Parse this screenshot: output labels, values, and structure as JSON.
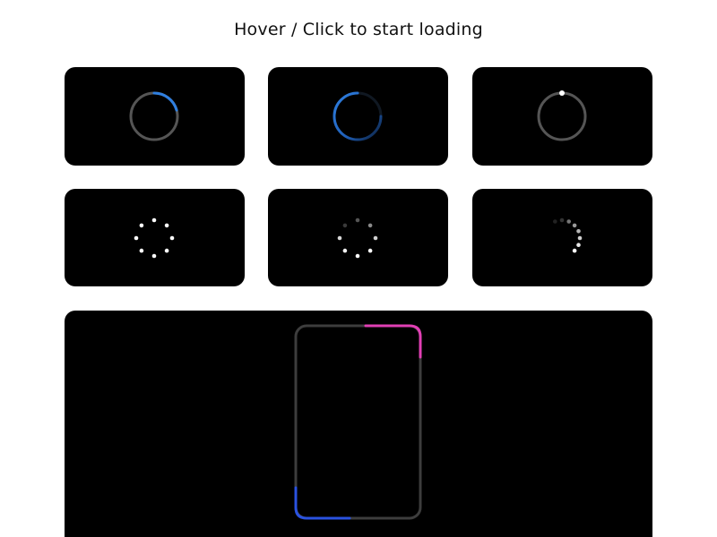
{
  "page": {
    "title": "Hover / Click to start loading"
  },
  "colors": {
    "background": "#ffffff",
    "card": "#000000",
    "track": "#4a4a4a",
    "accent_blue": "#2f7fe0",
    "accent_deep_blue": "#2a52e0",
    "accent_magenta": "#e13fb4",
    "dot": "#ffffff"
  },
  "loaders": [
    {
      "name": "ring-arc-loader"
    },
    {
      "name": "ring-gradient-loader"
    },
    {
      "name": "ring-dot-loader"
    },
    {
      "name": "dots-circle-loader"
    },
    {
      "name": "dots-fading-loader"
    },
    {
      "name": "dots-partial-loader"
    },
    {
      "name": "rounded-rect-loader"
    }
  ]
}
